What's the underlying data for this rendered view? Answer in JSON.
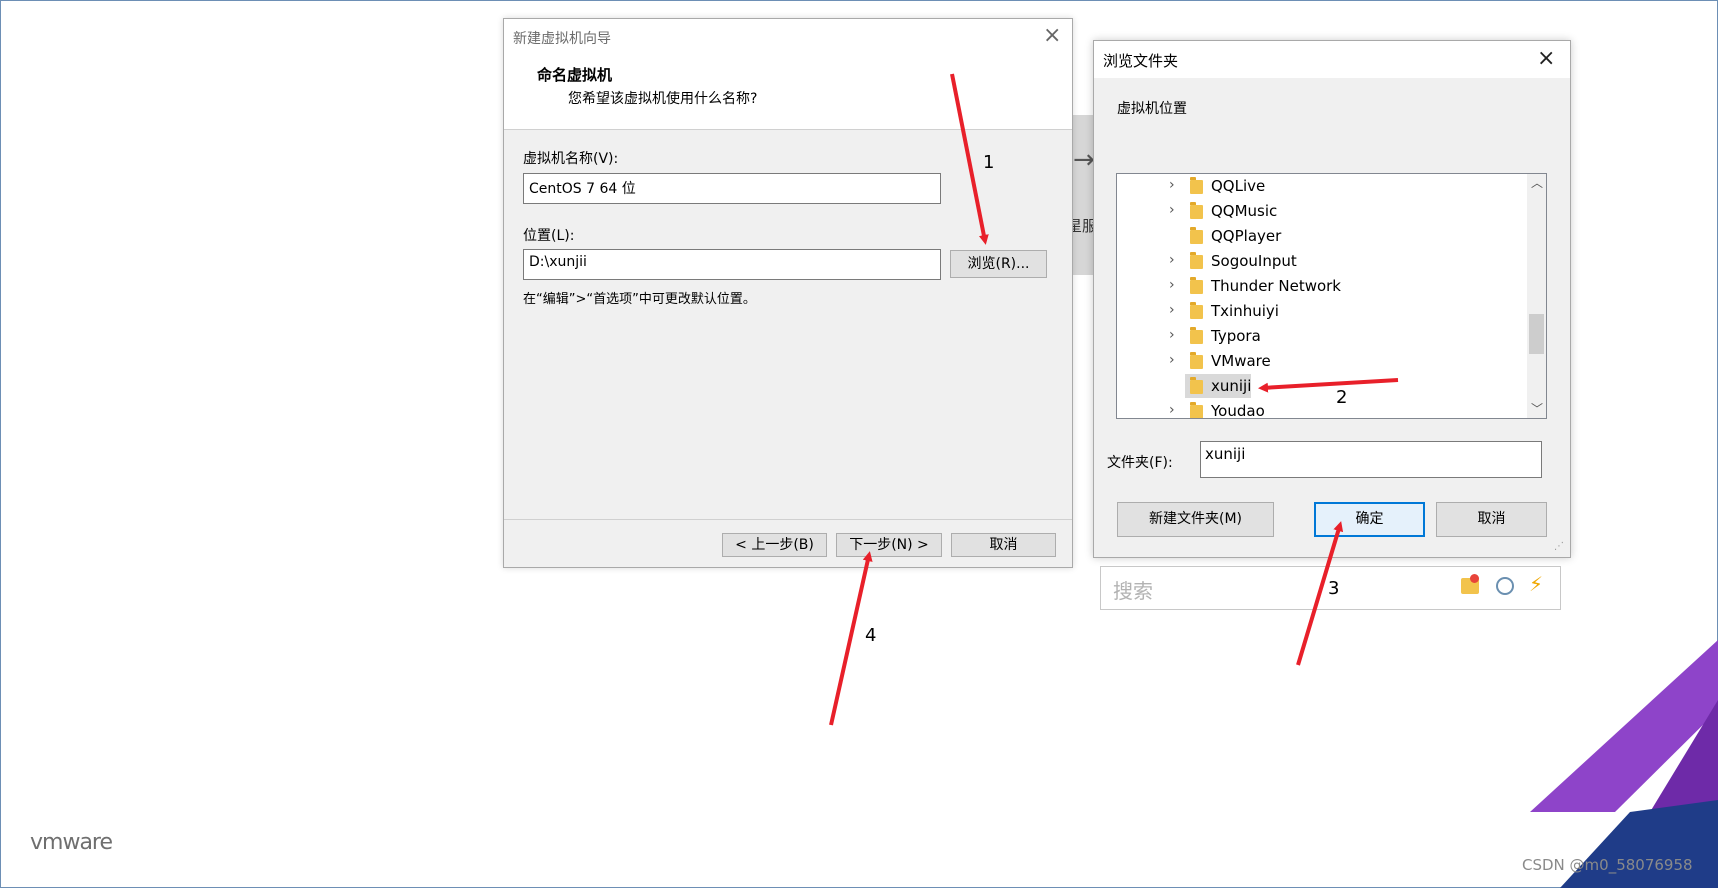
{
  "wizard": {
    "title": "新建虚拟机向导",
    "header_title": "命名虚拟机",
    "header_subtitle": "您希望该虚拟机使用什么名称?",
    "name_label": "虚拟机名称(V):",
    "name_value": "CentOS 7 64 位",
    "location_label": "位置(L):",
    "location_value": "D:\\xunjii",
    "browse_button": "浏览(R)...",
    "hint": "在“编辑”>“首选项”中可更改默认位置。",
    "back_button": "< 上一步(B)",
    "next_button": "下一步(N) >",
    "cancel_button": "取消"
  },
  "browse_dialog": {
    "title": "浏览文件夹",
    "description": "虚拟机位置",
    "folders": [
      {
        "name": "QQLive",
        "expandable": true,
        "selected": false
      },
      {
        "name": "QQMusic",
        "expandable": true,
        "selected": false
      },
      {
        "name": "QQPlayer",
        "expandable": false,
        "selected": false
      },
      {
        "name": "SogouInput",
        "expandable": true,
        "selected": false
      },
      {
        "name": "Thunder Network",
        "expandable": true,
        "selected": false
      },
      {
        "name": "Txinhuiyi",
        "expandable": true,
        "selected": false
      },
      {
        "name": "Typora",
        "expandable": true,
        "selected": false
      },
      {
        "name": "VMware",
        "expandable": true,
        "selected": false
      },
      {
        "name": "xuniji",
        "expandable": false,
        "selected": true
      },
      {
        "name": "Youdao",
        "expandable": true,
        "selected": false
      }
    ],
    "folder_label": "文件夹(F):",
    "folder_value": "xuniji",
    "new_folder_button": "新建文件夹(M)",
    "ok_button": "确定",
    "cancel_button": "取消"
  },
  "search": {
    "placeholder": "搜索"
  },
  "background_fragment": "星服",
  "annotations": [
    "1",
    "2",
    "3",
    "4"
  ],
  "brand": {
    "logo_text": "vmware",
    "watermark": "CSDN @m0_58076958"
  },
  "colors": {
    "arrow": "#e8202a",
    "accent": "#0078d7",
    "vmware_purple": "#7b2fbe"
  }
}
